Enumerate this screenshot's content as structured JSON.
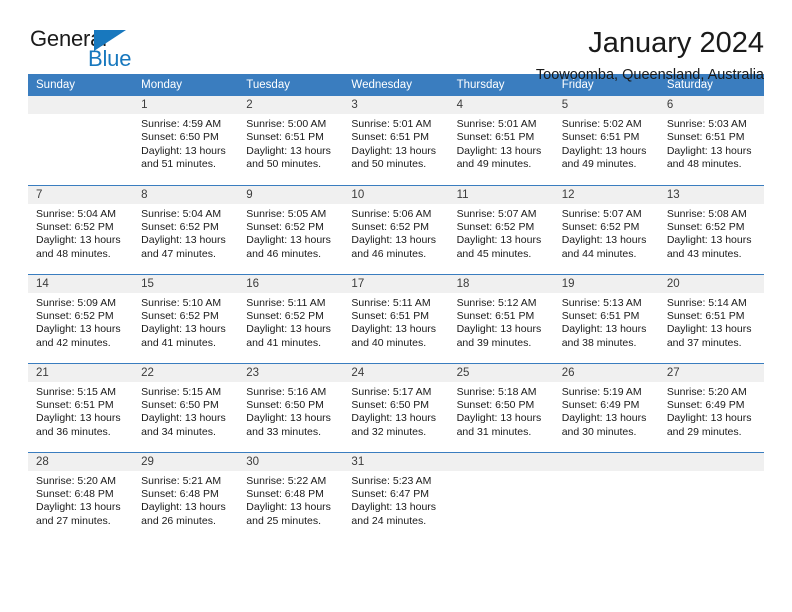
{
  "brand": {
    "name_part1": "General",
    "name_part2": "Blue",
    "triangle_icon": "triangle-icon",
    "accent_color": "#1878be"
  },
  "header": {
    "title": "January 2024",
    "subtitle": "Toowoomba, Queensland, Australia"
  },
  "calendar": {
    "header_bg": "#3a7dbf",
    "daynum_bg": "#f0f0f0",
    "weekday_headers": [
      "Sunday",
      "Monday",
      "Tuesday",
      "Wednesday",
      "Thursday",
      "Friday",
      "Saturday"
    ],
    "weeks": [
      [
        {
          "day": "",
          "lines": []
        },
        {
          "day": "1",
          "lines": [
            "Sunrise: 4:59 AM",
            "Sunset: 6:50 PM",
            "Daylight: 13 hours",
            "and 51 minutes."
          ]
        },
        {
          "day": "2",
          "lines": [
            "Sunrise: 5:00 AM",
            "Sunset: 6:51 PM",
            "Daylight: 13 hours",
            "and 50 minutes."
          ]
        },
        {
          "day": "3",
          "lines": [
            "Sunrise: 5:01 AM",
            "Sunset: 6:51 PM",
            "Daylight: 13 hours",
            "and 50 minutes."
          ]
        },
        {
          "day": "4",
          "lines": [
            "Sunrise: 5:01 AM",
            "Sunset: 6:51 PM",
            "Daylight: 13 hours",
            "and 49 minutes."
          ]
        },
        {
          "day": "5",
          "lines": [
            "Sunrise: 5:02 AM",
            "Sunset: 6:51 PM",
            "Daylight: 13 hours",
            "and 49 minutes."
          ]
        },
        {
          "day": "6",
          "lines": [
            "Sunrise: 5:03 AM",
            "Sunset: 6:51 PM",
            "Daylight: 13 hours",
            "and 48 minutes."
          ]
        }
      ],
      [
        {
          "day": "7",
          "lines": [
            "Sunrise: 5:04 AM",
            "Sunset: 6:52 PM",
            "Daylight: 13 hours",
            "and 48 minutes."
          ]
        },
        {
          "day": "8",
          "lines": [
            "Sunrise: 5:04 AM",
            "Sunset: 6:52 PM",
            "Daylight: 13 hours",
            "and 47 minutes."
          ]
        },
        {
          "day": "9",
          "lines": [
            "Sunrise: 5:05 AM",
            "Sunset: 6:52 PM",
            "Daylight: 13 hours",
            "and 46 minutes."
          ]
        },
        {
          "day": "10",
          "lines": [
            "Sunrise: 5:06 AM",
            "Sunset: 6:52 PM",
            "Daylight: 13 hours",
            "and 46 minutes."
          ]
        },
        {
          "day": "11",
          "lines": [
            "Sunrise: 5:07 AM",
            "Sunset: 6:52 PM",
            "Daylight: 13 hours",
            "and 45 minutes."
          ]
        },
        {
          "day": "12",
          "lines": [
            "Sunrise: 5:07 AM",
            "Sunset: 6:52 PM",
            "Daylight: 13 hours",
            "and 44 minutes."
          ]
        },
        {
          "day": "13",
          "lines": [
            "Sunrise: 5:08 AM",
            "Sunset: 6:52 PM",
            "Daylight: 13 hours",
            "and 43 minutes."
          ]
        }
      ],
      [
        {
          "day": "14",
          "lines": [
            "Sunrise: 5:09 AM",
            "Sunset: 6:52 PM",
            "Daylight: 13 hours",
            "and 42 minutes."
          ]
        },
        {
          "day": "15",
          "lines": [
            "Sunrise: 5:10 AM",
            "Sunset: 6:52 PM",
            "Daylight: 13 hours",
            "and 41 minutes."
          ]
        },
        {
          "day": "16",
          "lines": [
            "Sunrise: 5:11 AM",
            "Sunset: 6:52 PM",
            "Daylight: 13 hours",
            "and 41 minutes."
          ]
        },
        {
          "day": "17",
          "lines": [
            "Sunrise: 5:11 AM",
            "Sunset: 6:51 PM",
            "Daylight: 13 hours",
            "and 40 minutes."
          ]
        },
        {
          "day": "18",
          "lines": [
            "Sunrise: 5:12 AM",
            "Sunset: 6:51 PM",
            "Daylight: 13 hours",
            "and 39 minutes."
          ]
        },
        {
          "day": "19",
          "lines": [
            "Sunrise: 5:13 AM",
            "Sunset: 6:51 PM",
            "Daylight: 13 hours",
            "and 38 minutes."
          ]
        },
        {
          "day": "20",
          "lines": [
            "Sunrise: 5:14 AM",
            "Sunset: 6:51 PM",
            "Daylight: 13 hours",
            "and 37 minutes."
          ]
        }
      ],
      [
        {
          "day": "21",
          "lines": [
            "Sunrise: 5:15 AM",
            "Sunset: 6:51 PM",
            "Daylight: 13 hours",
            "and 36 minutes."
          ]
        },
        {
          "day": "22",
          "lines": [
            "Sunrise: 5:15 AM",
            "Sunset: 6:50 PM",
            "Daylight: 13 hours",
            "and 34 minutes."
          ]
        },
        {
          "day": "23",
          "lines": [
            "Sunrise: 5:16 AM",
            "Sunset: 6:50 PM",
            "Daylight: 13 hours",
            "and 33 minutes."
          ]
        },
        {
          "day": "24",
          "lines": [
            "Sunrise: 5:17 AM",
            "Sunset: 6:50 PM",
            "Daylight: 13 hours",
            "and 32 minutes."
          ]
        },
        {
          "day": "25",
          "lines": [
            "Sunrise: 5:18 AM",
            "Sunset: 6:50 PM",
            "Daylight: 13 hours",
            "and 31 minutes."
          ]
        },
        {
          "day": "26",
          "lines": [
            "Sunrise: 5:19 AM",
            "Sunset: 6:49 PM",
            "Daylight: 13 hours",
            "and 30 minutes."
          ]
        },
        {
          "day": "27",
          "lines": [
            "Sunrise: 5:20 AM",
            "Sunset: 6:49 PM",
            "Daylight: 13 hours",
            "and 29 minutes."
          ]
        }
      ],
      [
        {
          "day": "28",
          "lines": [
            "Sunrise: 5:20 AM",
            "Sunset: 6:48 PM",
            "Daylight: 13 hours",
            "and 27 minutes."
          ]
        },
        {
          "day": "29",
          "lines": [
            "Sunrise: 5:21 AM",
            "Sunset: 6:48 PM",
            "Daylight: 13 hours",
            "and 26 minutes."
          ]
        },
        {
          "day": "30",
          "lines": [
            "Sunrise: 5:22 AM",
            "Sunset: 6:48 PM",
            "Daylight: 13 hours",
            "and 25 minutes."
          ]
        },
        {
          "day": "31",
          "lines": [
            "Sunrise: 5:23 AM",
            "Sunset: 6:47 PM",
            "Daylight: 13 hours",
            "and 24 minutes."
          ]
        },
        {
          "day": "",
          "lines": []
        },
        {
          "day": "",
          "lines": []
        },
        {
          "day": "",
          "lines": []
        }
      ]
    ]
  }
}
